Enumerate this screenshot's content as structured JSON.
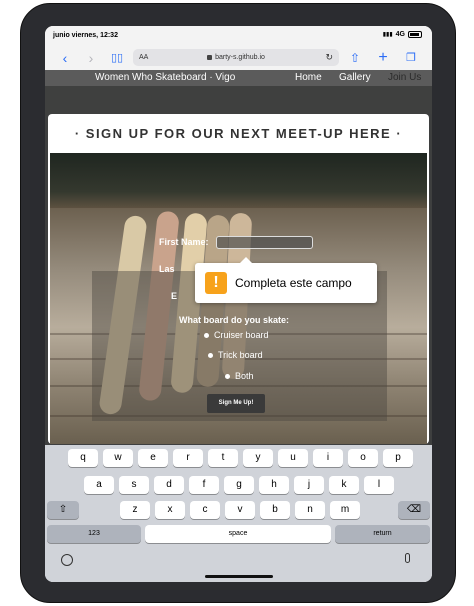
{
  "status": {
    "time": "junio viernes, 12:32",
    "signal": "4G"
  },
  "browser": {
    "aa": "AA",
    "url": "barty-s.github.io"
  },
  "nav": {
    "brand": "Women Who Skateboard · Vigo",
    "links": [
      "Home",
      "Gallery",
      "Join Us"
    ]
  },
  "form": {
    "heading": "· SIGN UP FOR OUR NEXT MEET-UP HERE ·",
    "first_name_label": "First Name:",
    "last_name_label": "Las",
    "email_label": "E",
    "board_question": "What board do you skate:",
    "options": [
      "Cruiser board",
      "Trick board",
      "Both"
    ],
    "submit": "Sign Me Up!"
  },
  "tooltip": {
    "icon": "!",
    "message": "Completa este campo"
  },
  "keyboard": {
    "row1": [
      "q",
      "w",
      "e",
      "r",
      "t",
      "y",
      "u",
      "i",
      "o",
      "p"
    ],
    "row2": [
      "a",
      "s",
      "d",
      "f",
      "g",
      "h",
      "j",
      "k",
      "l"
    ],
    "row3": [
      "z",
      "x",
      "c",
      "v",
      "b",
      "n",
      "m"
    ],
    "numbers": "123",
    "space": "space",
    "return": "return"
  }
}
